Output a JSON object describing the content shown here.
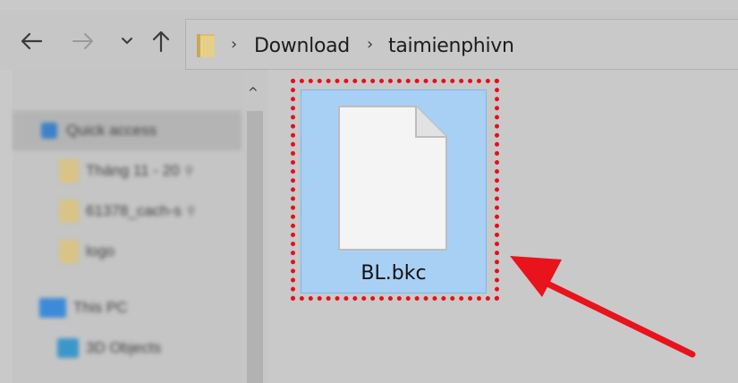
{
  "navigation": {
    "back_icon": "arrow-left-icon",
    "forward_icon": "arrow-right-icon",
    "recent_icon": "chevron-down-icon",
    "up_icon": "arrow-up-icon"
  },
  "address_bar": {
    "folder_icon": "folder-icon",
    "separator": "›",
    "breadcrumbs": [
      "Download",
      "taimienphivn"
    ]
  },
  "sidebar": {
    "scroll_up": "^",
    "items": [
      {
        "label": "Quick access",
        "icon": "star-icon"
      },
      {
        "label": "Tháng 11 - 20",
        "icon": "folder-icon",
        "pin": "⚲"
      },
      {
        "label": "61378_cach-s",
        "icon": "folder-icon",
        "pin": "⚲"
      },
      {
        "label": "logo",
        "icon": "folder-icon"
      },
      {
        "label": "This PC",
        "icon": "computer-icon"
      },
      {
        "label": "3D Objects",
        "icon": "cube-icon"
      }
    ]
  },
  "content": {
    "file": {
      "name": "BL.bkc",
      "icon": "document-icon"
    }
  },
  "colors": {
    "selection_fill": "#a8d0f4",
    "highlight": "#e60e1c",
    "arrow": "#e8131b"
  }
}
